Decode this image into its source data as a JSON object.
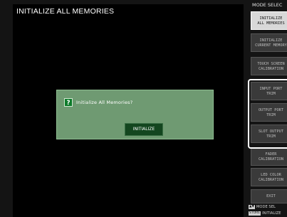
{
  "main": {
    "title": "INITIALIZE ALL MEMORIES"
  },
  "dialog": {
    "icon": "?",
    "message": "Initialize All Memories?",
    "button_label": "INITIALIZE"
  },
  "sidebar": {
    "header": "MODE SELEC",
    "items": [
      {
        "label": "INITIALIZE\nALL MEMORIES",
        "selected": true
      },
      {
        "label": "INITIALIZE\nCURRENT MEMORY",
        "selected": false
      },
      {
        "label": "TOUCH SCREEN\nCALIBRATION",
        "selected": false
      },
      {
        "label": "INPUT PORT\nTRIM",
        "selected": false
      },
      {
        "label": "OUTPUT PORT\nTRIM",
        "selected": false
      },
      {
        "label": "SLOT OUTPUT\nTRIM",
        "selected": false
      },
      {
        "label": "FADER\nCALIBRATION",
        "selected": false
      },
      {
        "label": "LED COLOR\nCALIBRATION",
        "selected": false
      },
      {
        "label": "EXIT",
        "selected": false
      }
    ],
    "footer": [
      {
        "key": "▲▼",
        "text": "MODE SEL"
      },
      {
        "key": "STORE",
        "text": "INITIALIZE"
      }
    ]
  },
  "colors": {
    "dialog_bg": "#6f9a72",
    "dialog_button": "#13461f",
    "selected_item": "#d8d8d8",
    "menu_item": "#3a3a3a"
  }
}
